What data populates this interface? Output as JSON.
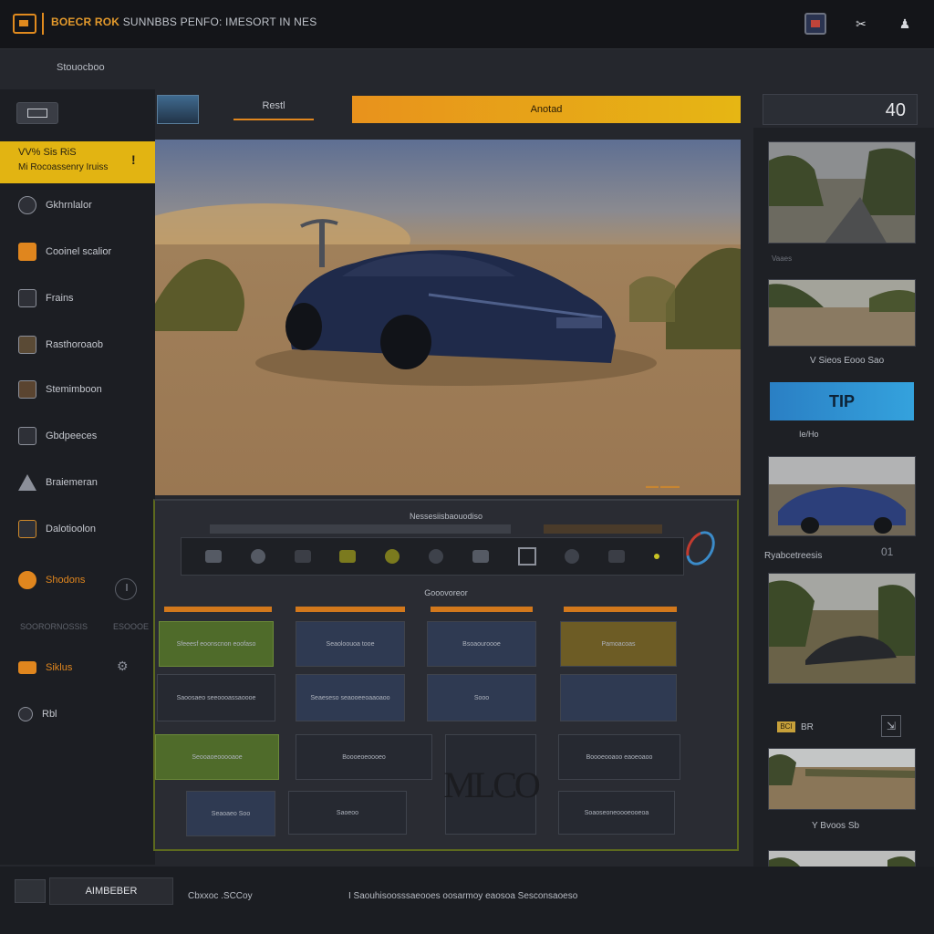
{
  "app": {
    "title_accent": "BOECR ROK",
    "title_rest": "SUNNBBS PENFO: IMESORT IN NES",
    "section_label": "Stouocboo"
  },
  "topbar": {
    "icons": [
      "media-icon",
      "tools-icon",
      "user-icon"
    ],
    "tools_glyph": "✂",
    "user_glyph": "♟"
  },
  "sidebar": {
    "active_item": {
      "line1": "VV% Sis RiS",
      "line2": "Mi Rocoassenry Iruiss",
      "mark": "!"
    },
    "items": [
      {
        "label": "Gkhrnlalor",
        "icon": "globe-icon"
      },
      {
        "label": "Cooinel scalior",
        "icon": "folder-icon"
      },
      {
        "label": "Frains",
        "icon": "phone-icon"
      },
      {
        "label": "Rasthoroaob",
        "icon": "image-icon"
      },
      {
        "label": "Stemimboon",
        "icon": "film-icon"
      },
      {
        "label": "Gbdpeeces",
        "icon": "brush-icon"
      },
      {
        "label": "Braiemeran",
        "icon": "warning-icon"
      },
      {
        "label": "Dalotioolon",
        "icon": "calendar-icon"
      },
      {
        "label": "Shodons",
        "icon": "chat-icon"
      },
      {
        "label": "Siklus",
        "icon": "tag-icon"
      },
      {
        "label": "Rbl",
        "icon": "shield-icon"
      }
    ],
    "divider_left": "SOORORNOSSIS",
    "divider_right": "ESOOOE",
    "gear_glyph": "⚙"
  },
  "toolbar": {
    "tab_label": "Restl",
    "action_label": "Anotad",
    "counter": "40"
  },
  "editor": {
    "title": "Nessesiisbaouodiso",
    "effects_title": "Gooovoreor",
    "tiles": [
      {
        "label": "Sfeeesf eoonscnon eoofaso"
      },
      {
        "label": "Seaoloouoa tooe"
      },
      {
        "label": "Bsoaouroooe"
      },
      {
        "label": "Pamoacoas"
      },
      {
        "label": "Saoosaeo seeoooassaoooe"
      },
      {
        "label": "Seaeseso seaooeeoaaoaoo"
      },
      {
        "label": "Sooo"
      },
      {
        "label": ""
      },
      {
        "label": "Seooaoeooooaoe"
      },
      {
        "label": "Boooeoeoooeo"
      },
      {
        "label": "MLCO"
      },
      {
        "label": "Boooeooaoo eaoeoaoo"
      },
      {
        "label": "Seaoaeo Soo"
      },
      {
        "label": "Saoeoo"
      },
      {
        "label": "Soaoseoneoooeooeoa"
      }
    ]
  },
  "right_panel": {
    "labels": [
      "Vaaes",
      "V Sieos Eooo Sao",
      "Ie/Ho",
      "Ryabcetreesis",
      "BR",
      "Y Bvoos Sb"
    ],
    "tip": "TIP",
    "badge": "BCI",
    "count_label": "01"
  },
  "bottom": {
    "button_label": "AIMBEBER",
    "left_text": "Cbxxoc .SCCoy",
    "status": "I Saouhisoosssaeooes oosarmoy eaosoa Sesconsaoeso"
  }
}
